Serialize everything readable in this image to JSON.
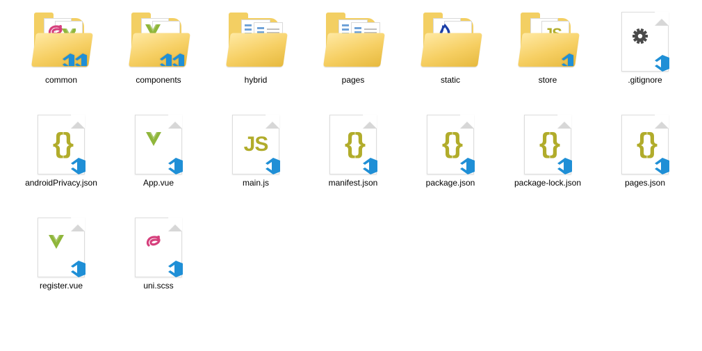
{
  "items": [
    {
      "label": "common",
      "type": "folder-sass-vue"
    },
    {
      "label": "components",
      "type": "folder-vue"
    },
    {
      "label": "hybrid",
      "type": "folder-spiral"
    },
    {
      "label": "pages",
      "type": "folder-spiral"
    },
    {
      "label": "static",
      "type": "folder-flame"
    },
    {
      "label": "store",
      "type": "folder-js"
    },
    {
      "label": ".gitignore",
      "type": "file-gear"
    },
    {
      "label": "androidPrivacy.json",
      "type": "file-json"
    },
    {
      "label": "App.vue",
      "type": "file-vue"
    },
    {
      "label": "main.js",
      "type": "file-js"
    },
    {
      "label": "manifest.json",
      "type": "file-json"
    },
    {
      "label": "package.json",
      "type": "file-json"
    },
    {
      "label": "package-lock.json",
      "type": "file-json"
    },
    {
      "label": "pages.json",
      "type": "file-json"
    },
    {
      "label": "register.vue",
      "type": "file-vue"
    },
    {
      "label": "uni.scss",
      "type": "file-sass"
    }
  ],
  "colors": {
    "vue": "#8fb63b",
    "js": "#b1ac2b",
    "sass": "#d6407d",
    "vs": "#1f8fd6",
    "gear": "#4a4a4a",
    "flame1": "#1c3fa8",
    "flame2": "#ffffff"
  }
}
